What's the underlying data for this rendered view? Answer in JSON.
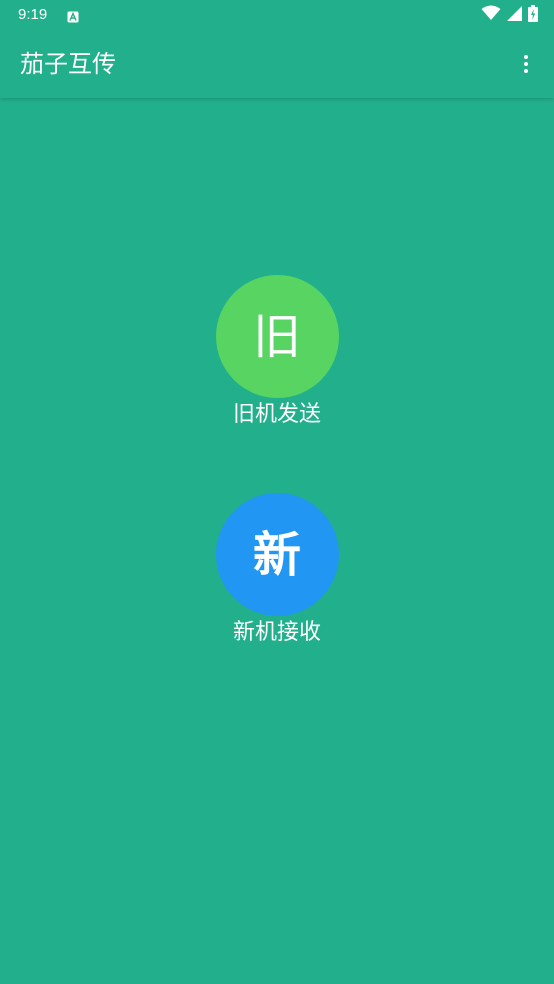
{
  "status_bar": {
    "time": "9:19",
    "notification_icon": "a-box-icon",
    "icons": [
      "wifi-icon",
      "signal-icon",
      "battery-icon"
    ]
  },
  "app_bar": {
    "title": "茄子互传",
    "menu_icon": "more-vert-icon"
  },
  "actions": {
    "old": {
      "circle_text": "旧",
      "label": "旧机发送",
      "color": "#57D461"
    },
    "new": {
      "circle_text": "新",
      "label": "新机接收",
      "color": "#2196F3"
    }
  },
  "colors": {
    "background": "#22AF8C",
    "text": "#FFFFFF"
  }
}
